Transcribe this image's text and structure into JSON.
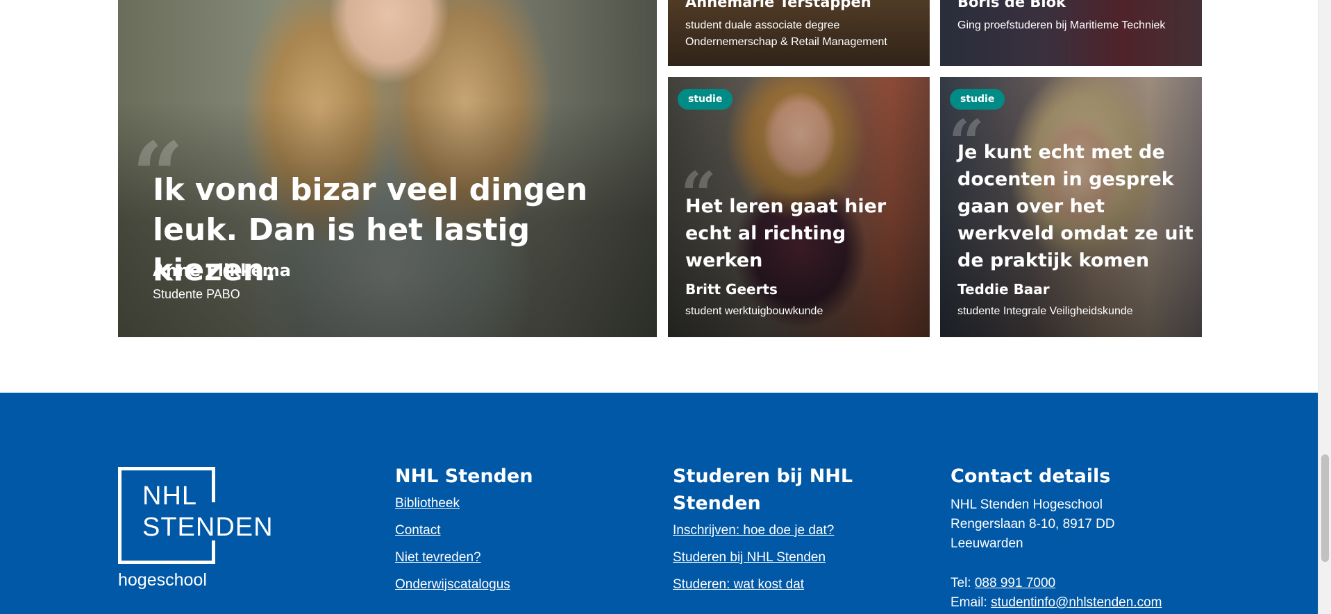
{
  "cards": {
    "big": {
      "quote": "Ik vond bizar veel dingen leuk. Dan is het lastig kiezen.",
      "name": "Anne Flikkema",
      "role": "Studente PABO"
    },
    "top_1": {
      "name": "Annemarie Terstappen",
      "role": "student duale associate degree Ondernemerschap & Retail Management"
    },
    "top_2": {
      "name": "Boris de Blok",
      "role": "Ging proefstuderen bij Maritieme Techniek"
    },
    "mid_1": {
      "badge": "studie",
      "quote": "Het leren gaat hier echt al richting werken",
      "name": "Britt Geerts",
      "role": "student werktuigbouwkunde"
    },
    "mid_2": {
      "badge": "studie",
      "quote": "Je kunt echt met de docenten in gesprek gaan over het werkveld omdat ze uit de praktijk komen",
      "name": "Teddie Baar",
      "role": "studente Integrale Veiligheidskunde"
    },
    "quote_mark": "“"
  },
  "footer": {
    "logo": {
      "line1": "NHL",
      "line2": "STENDEN",
      "sub": "hogeschool"
    },
    "nhl": {
      "title": "NHL Stenden",
      "links": [
        "Bibliotheek",
        "Contact",
        "Niet tevreden?",
        "Onderwijscatalogus"
      ]
    },
    "studeren": {
      "title": "Studeren bij NHL Stenden",
      "links": [
        "Inschrijven: hoe doe je dat?",
        "Studeren bij NHL Stenden",
        "Studeren: wat kost dat"
      ]
    },
    "contact": {
      "title": "Contact details",
      "org": "NHL Stenden Hogeschool",
      "address1": "Rengerslaan 8-10, 8917 DD",
      "address2": "Leeuwarden",
      "tel_label": "Tel: ",
      "tel": "088 991 7000",
      "email_label": "Email: ",
      "email": "studentinfo@nhlstenden.com"
    }
  },
  "colors": {
    "footer_bg": "#0058a6",
    "badge_bg": "#008b87"
  }
}
